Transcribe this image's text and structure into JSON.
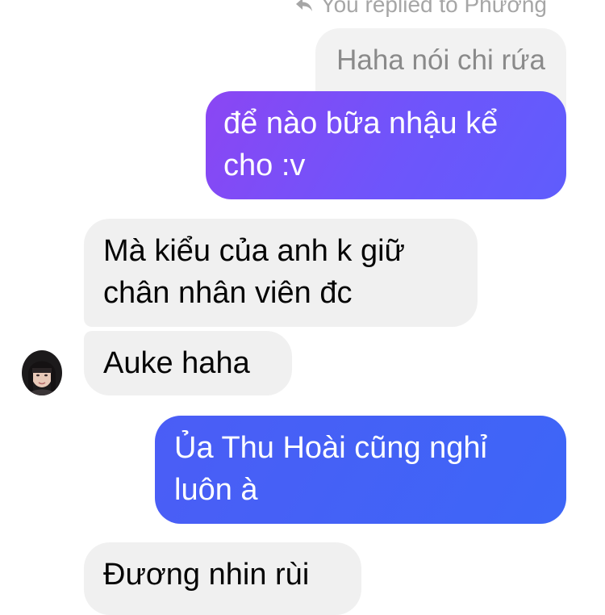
{
  "reply_indicator": {
    "icon": "reply-arrow-icon",
    "text": "You replied to Phương"
  },
  "messages": [
    {
      "id": "quoted",
      "direction": "reply-quote",
      "text": "Haha nói chi rứa"
    },
    {
      "id": "m1",
      "direction": "outgoing",
      "text": "để nào bữa nhậu kể cho :v"
    },
    {
      "id": "m2",
      "direction": "incoming",
      "text": "Mà kiểu của anh k giữ chân nhân viên đc"
    },
    {
      "id": "m3",
      "direction": "incoming",
      "text": "Auke haha"
    },
    {
      "id": "m4",
      "direction": "outgoing",
      "text": "Ủa Thu Hoài cũng nghỉ luôn à"
    },
    {
      "id": "m5",
      "direction": "incoming",
      "text": "Đương nhin rùi"
    }
  ],
  "colors": {
    "outgoing_purple": "#7b4ef8",
    "outgoing_blue": "#4560f7",
    "incoming_bg": "#f0f0f0",
    "quote_bg": "#f2f2f2",
    "meta_text": "#a6a6a6"
  }
}
